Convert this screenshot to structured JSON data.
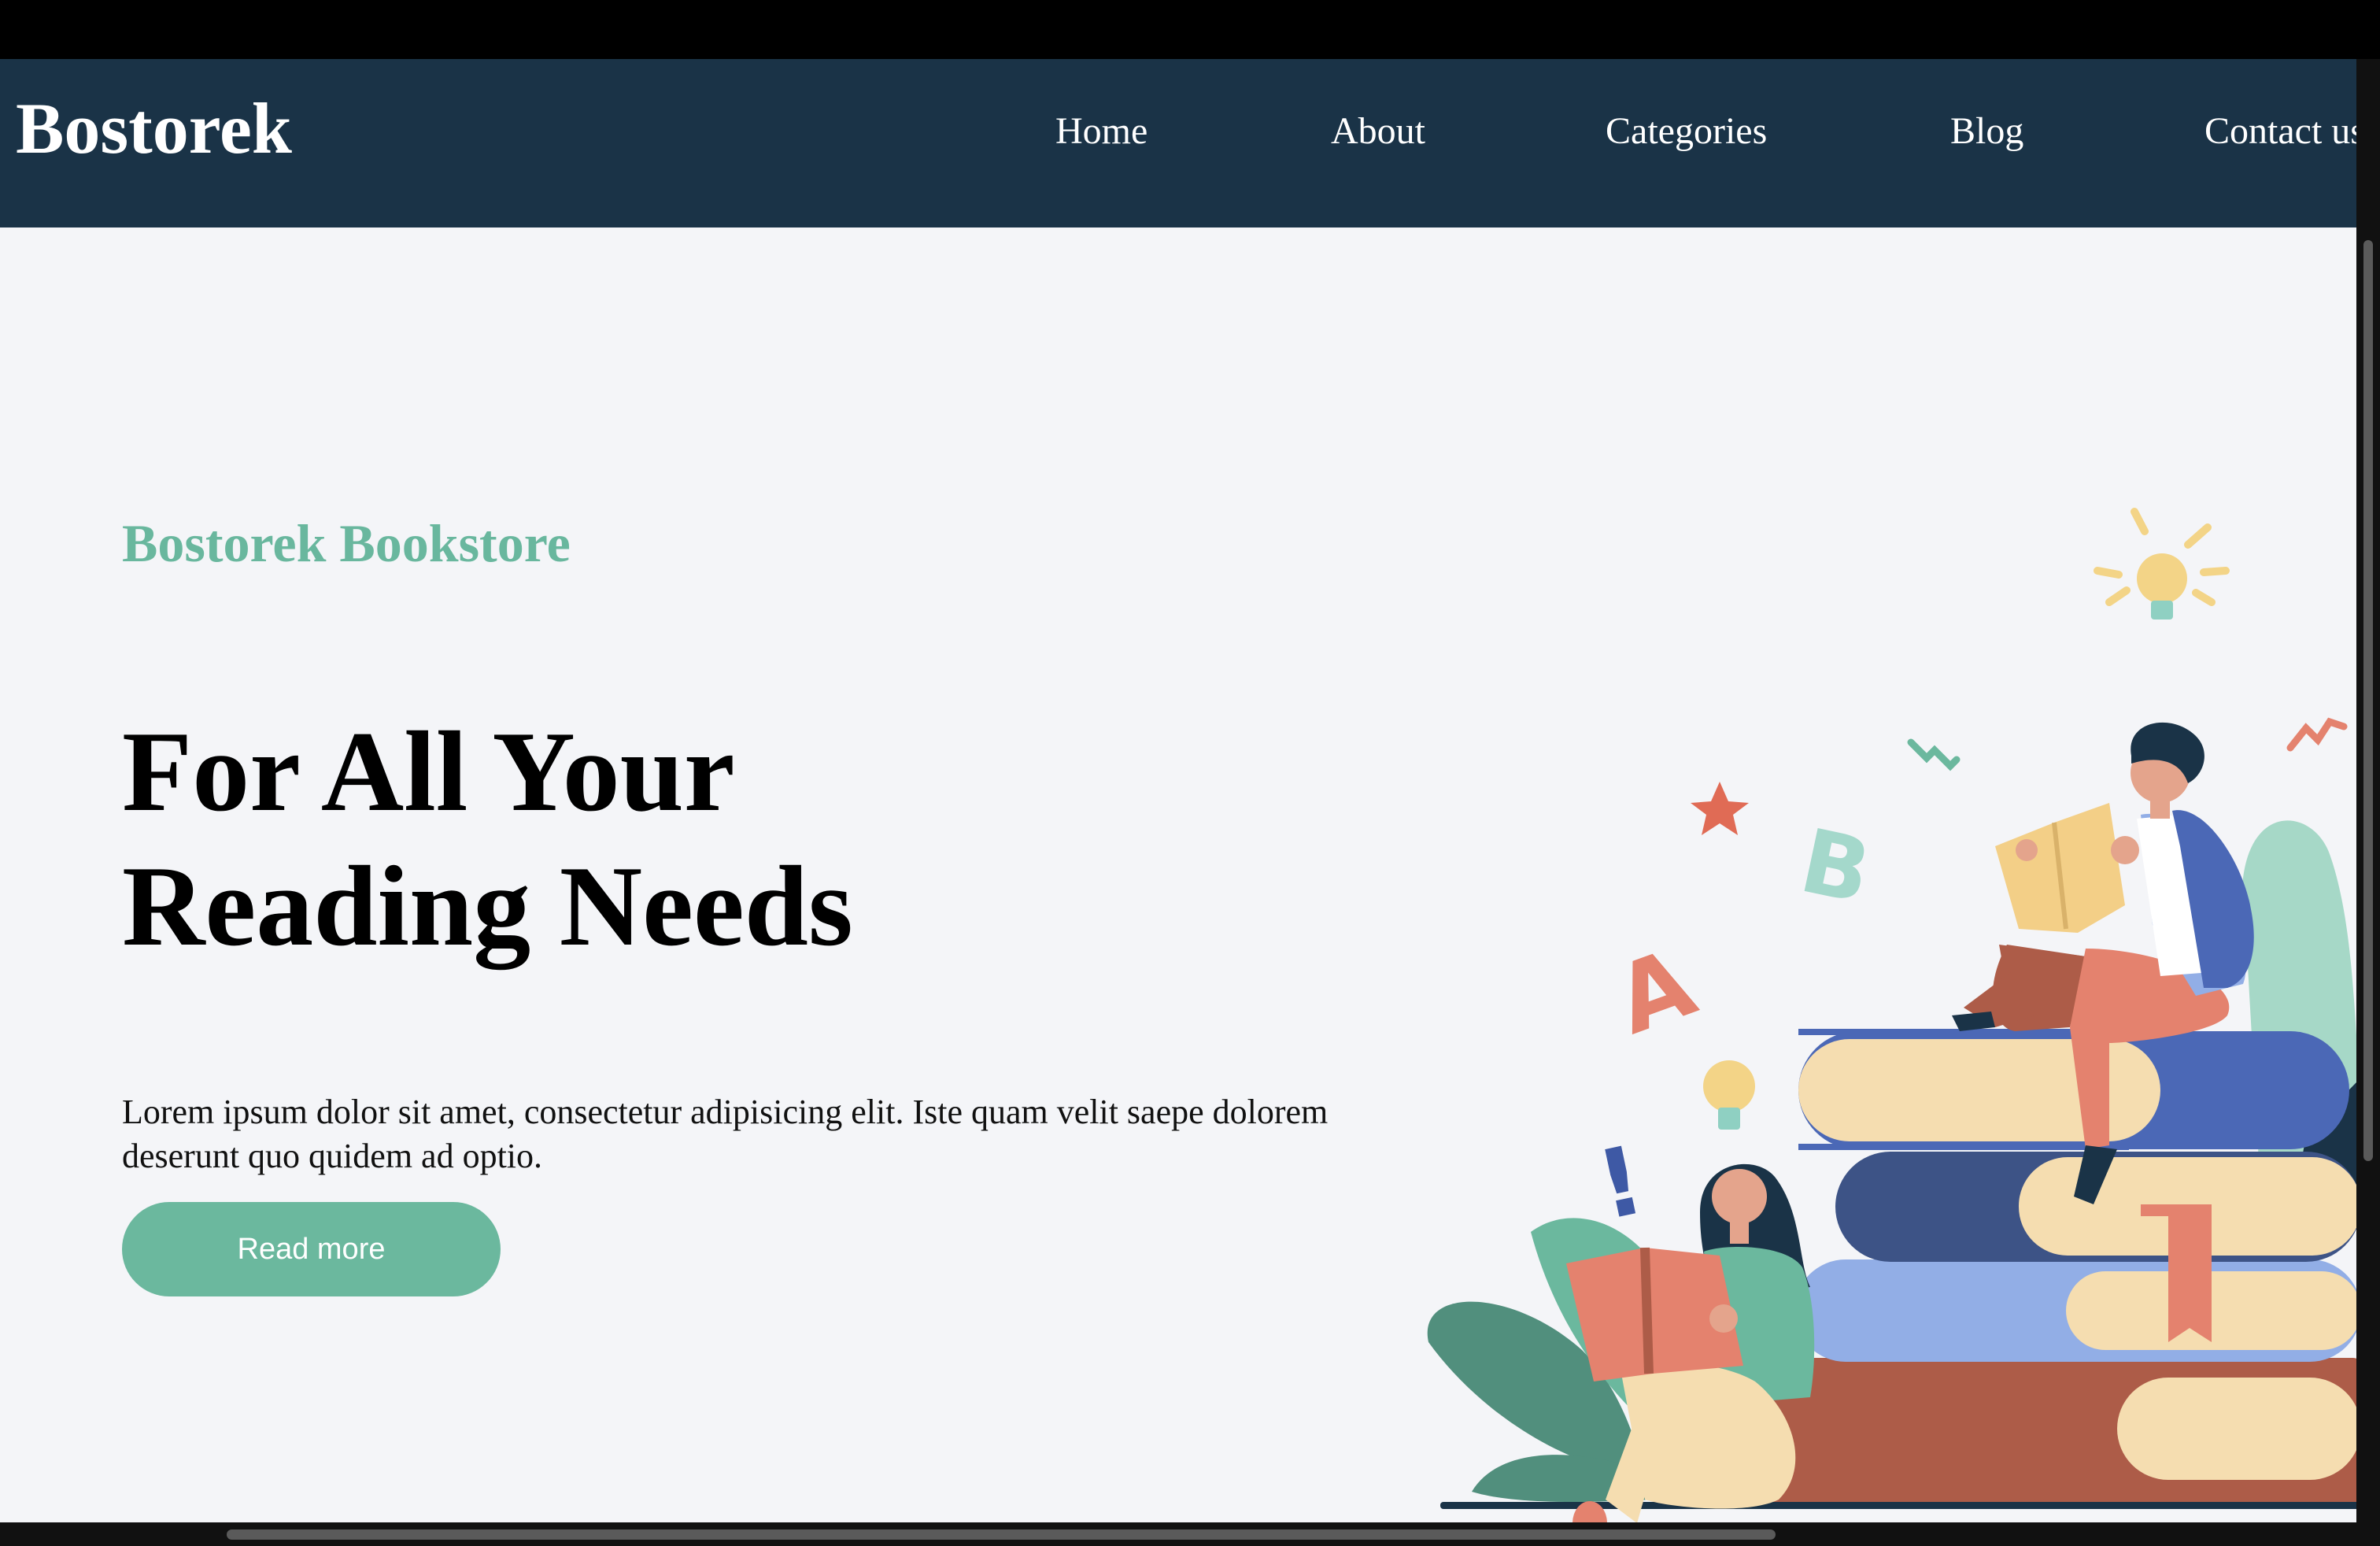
{
  "nav": {
    "brand": "Bostorek",
    "links": [
      "Home",
      "About",
      "Categories",
      "Blog",
      "Contact us"
    ]
  },
  "hero": {
    "subtitle": "Bostorek Bookstore",
    "headline_line1": "For All Your",
    "headline_line2": "Reading Needs",
    "description": "Lorem ipsum dolor sit amet, consectetur adipisicing elit. Iste quam velit saepe dolorem deserunt quo quidem ad optio.",
    "button_label": "Read more"
  },
  "illustration": {
    "letters": [
      "A",
      "B",
      "!"
    ]
  },
  "colors": {
    "navbar": "#1a3347",
    "accent": "#6bb89e",
    "page_background": "#f4f5f8"
  },
  "icons": [
    "star-icon",
    "lightbulb-icon",
    "exclamation-icon"
  ]
}
